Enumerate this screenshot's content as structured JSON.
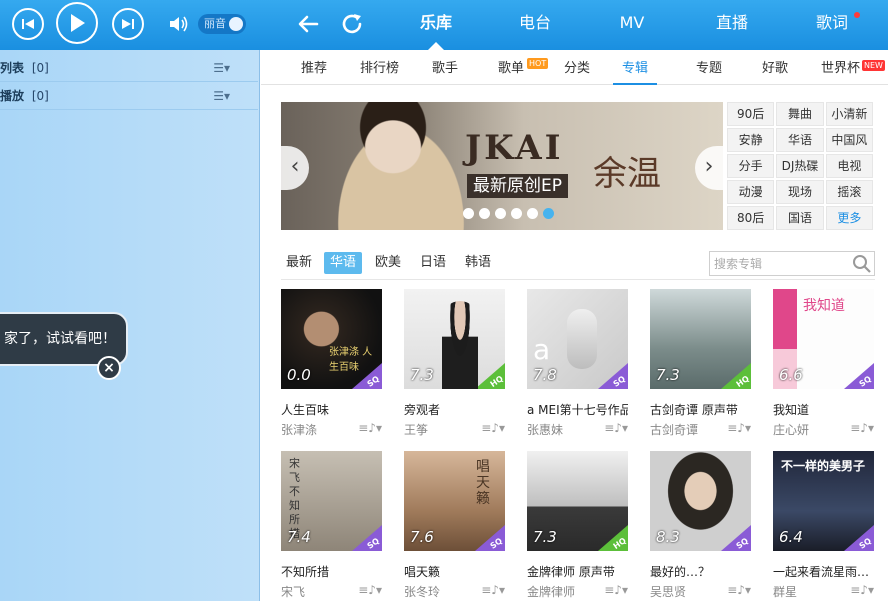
{
  "player": {
    "mode_label": "丽音"
  },
  "main_nav": {
    "tabs": [
      {
        "label": "乐库",
        "active": true
      },
      {
        "label": "电台",
        "active": false
      },
      {
        "label": "MV",
        "active": false
      },
      {
        "label": "直播",
        "active": false
      },
      {
        "label": "歌词",
        "active": false,
        "dot": true
      }
    ]
  },
  "left_panel": {
    "rows": [
      {
        "label": "列表",
        "count": "[0]"
      },
      {
        "label": "播放",
        "count": "[0]"
      }
    ],
    "tooltip": "家了，试试看吧！"
  },
  "sub_nav": {
    "tabs": [
      {
        "label": "推荐"
      },
      {
        "label": "排行榜"
      },
      {
        "label": "歌手"
      },
      {
        "label": "歌单",
        "badge": "HOT"
      },
      {
        "label": "分类"
      },
      {
        "label": "专辑",
        "active": true
      },
      {
        "label": "专题"
      },
      {
        "label": "好歌"
      },
      {
        "label": "世界杯",
        "badge": "NEW"
      }
    ]
  },
  "banner": {
    "title": "JKAI",
    "subtitle": "最新原创EP",
    "name": "余温",
    "prev": "‹",
    "next": "›",
    "dots": 6,
    "active_dot": 5
  },
  "genres": [
    "90后",
    "舞曲",
    "小清新",
    "安静",
    "华语",
    "中国风",
    "分手",
    "DJ热碟",
    "电视",
    "动漫",
    "现场",
    "摇滚",
    "80后",
    "国语",
    "更多"
  ],
  "filters": [
    {
      "label": "最新"
    },
    {
      "label": "华语",
      "active": true
    },
    {
      "label": "欧美"
    },
    {
      "label": "日语"
    },
    {
      "label": "韩语"
    }
  ],
  "search": {
    "placeholder": "搜索专辑"
  },
  "albums": [
    {
      "title": "人生百味",
      "artist": "张津涤",
      "score": "0.0",
      "quality": "SQ",
      "cover_text": "张津涤 人生百味"
    },
    {
      "title": "旁观者",
      "artist": "王筝",
      "score": "7.3",
      "quality": "HQ",
      "cover_text": ""
    },
    {
      "title": "a MEI第十七号作品",
      "artist": "张惠妹",
      "score": "7.8",
      "quality": "SQ",
      "cover_text": "a"
    },
    {
      "title": "古剑奇谭 原声带",
      "artist": "古剑奇谭",
      "score": "7.3",
      "quality": "HQ",
      "cover_text": ""
    },
    {
      "title": "我知道",
      "artist": "庄心妍",
      "score": "6.6",
      "quality": "SQ",
      "cover_text": "我知道"
    },
    {
      "title": "不知所措",
      "artist": "宋飞",
      "score": "7.4",
      "quality": "SQ",
      "cover_text": "宋飞 不知所措"
    },
    {
      "title": "唱天籁",
      "artist": "张冬玲",
      "score": "7.6",
      "quality": "SQ",
      "cover_text": "唱天籁"
    },
    {
      "title": "金牌律师 原声带",
      "artist": "金牌律师",
      "score": "7.3",
      "quality": "HQ",
      "cover_text": ""
    },
    {
      "title": "最好的…？",
      "artist": "吴思贤",
      "score": "8.3",
      "quality": "SQ",
      "cover_text": ""
    },
    {
      "title": "一起来看流星雨…",
      "artist": "群星",
      "score": "6.4",
      "quality": "SQ",
      "cover_text": "不一样的美男子"
    }
  ],
  "colors": {
    "topbar": "#1a8fe0",
    "accent": "#1c8fe3",
    "sq_badge": "#8a5bd6",
    "hq_badge": "#5cbf3a"
  },
  "icons": {
    "prev": "prev-track-icon",
    "play": "play-icon",
    "next": "next-track-icon",
    "volume": "volume-icon",
    "back": "back-arrow-icon",
    "refresh": "refresh-icon",
    "search": "search-icon",
    "add_to_list": "add-to-playlist-icon"
  }
}
